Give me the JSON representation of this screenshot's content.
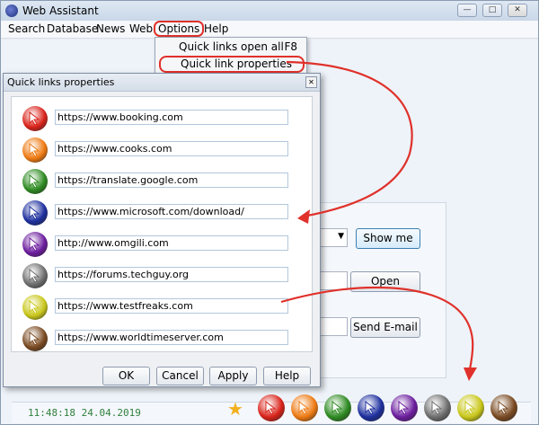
{
  "window": {
    "title": "Web Assistant",
    "min_glyph": "—",
    "max_glyph": "□",
    "close_glyph": "✕"
  },
  "menu": [
    "Search",
    "Database",
    "News",
    "Web",
    "Options",
    "Help"
  ],
  "options_menu": {
    "items": [
      {
        "label": "Quick links open all",
        "shortcut": "F8"
      },
      {
        "label": "Quick link properties",
        "shortcut": ""
      }
    ]
  },
  "main": {
    "show_me_label": "Show me",
    "open_label": "Open",
    "send_email_label": "Send E-mail",
    "dropdown_arrow": "▼"
  },
  "status": {
    "time": "11:48:18 24.04.2019"
  },
  "dialog": {
    "title": "Quick links properties",
    "close_glyph": "✕",
    "links": [
      {
        "url": "https://www.booking.com",
        "color": "#d9231a"
      },
      {
        "url": "https://www.cooks.com",
        "color": "#ee7a12"
      },
      {
        "url": "https://translate.google.com",
        "color": "#2e8b22"
      },
      {
        "url": "https://www.microsoft.com/download/",
        "color": "#1d2f9e"
      },
      {
        "url": "http://www.omgili.com",
        "color": "#6c1d9e"
      },
      {
        "url": "https://forums.techguy.org",
        "color": "#6e6e6e"
      },
      {
        "url": "https://www.testfreaks.com",
        "color": "#c9c71a"
      },
      {
        "url": "https://www.worldtimeserver.com",
        "color": "#7a4a22"
      }
    ],
    "buttons": {
      "ok": "OK",
      "cancel": "Cancel",
      "apply": "Apply",
      "help": "Help"
    }
  },
  "quicklinks_bar": {
    "colors": [
      "#d9231a",
      "#ee7a12",
      "#2e8b22",
      "#1d2f9e",
      "#6c1d9e",
      "#6e6e6e",
      "#c9c71a",
      "#7a4a22"
    ]
  },
  "accent": {
    "highlight": "#e0312b"
  }
}
